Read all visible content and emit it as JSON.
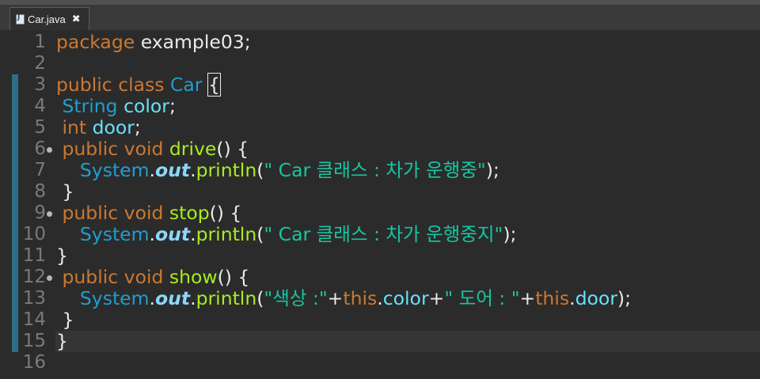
{
  "tab": {
    "label": "Car.java",
    "close": "✖"
  },
  "lines": [
    {
      "num": "1",
      "tokens": [
        {
          "t": "package ",
          "c": "kw"
        },
        {
          "t": "example03",
          "c": "punct"
        },
        {
          "t": ";",
          "c": "punct"
        }
      ]
    },
    {
      "num": "2",
      "tokens": []
    },
    {
      "num": "3",
      "tokens": [
        {
          "t": "public ",
          "c": "kw"
        },
        {
          "t": "class ",
          "c": "kw"
        },
        {
          "t": "Car ",
          "c": "type"
        },
        {
          "t": "{",
          "c": "punct bracket"
        }
      ]
    },
    {
      "num": "4",
      "tokens": [
        {
          "t": " String ",
          "c": "type"
        },
        {
          "t": "color",
          "c": "fld"
        },
        {
          "t": ";",
          "c": "punct"
        }
      ]
    },
    {
      "num": "5",
      "tokens": [
        {
          "t": " int ",
          "c": "kw"
        },
        {
          "t": "door",
          "c": "fld"
        },
        {
          "t": ";",
          "c": "punct"
        }
      ]
    },
    {
      "num": "6",
      "tokens": [
        {
          "t": " public ",
          "c": "kw"
        },
        {
          "t": "void ",
          "c": "kw"
        },
        {
          "t": "drive",
          "c": "meth"
        },
        {
          "t": "() {",
          "c": "punct"
        }
      ]
    },
    {
      "num": "7",
      "tokens": [
        {
          "t": "    System",
          "c": "sys"
        },
        {
          "t": ".",
          "c": "punct"
        },
        {
          "t": "out",
          "c": "out"
        },
        {
          "t": ".",
          "c": "punct"
        },
        {
          "t": "println",
          "c": "meth"
        },
        {
          "t": "(",
          "c": "punct"
        },
        {
          "t": "\" Car 클래스 : 차가 운행중\"",
          "c": "str"
        },
        {
          "t": ");",
          "c": "punct"
        }
      ]
    },
    {
      "num": "8",
      "tokens": [
        {
          "t": " }",
          "c": "punct"
        }
      ]
    },
    {
      "num": "9",
      "tokens": [
        {
          "t": " public ",
          "c": "kw"
        },
        {
          "t": "void ",
          "c": "kw"
        },
        {
          "t": "stop",
          "c": "meth"
        },
        {
          "t": "() {",
          "c": "punct"
        }
      ]
    },
    {
      "num": "10",
      "tokens": [
        {
          "t": "    System",
          "c": "sys"
        },
        {
          "t": ".",
          "c": "punct"
        },
        {
          "t": "out",
          "c": "out"
        },
        {
          "t": ".",
          "c": "punct"
        },
        {
          "t": "println",
          "c": "meth"
        },
        {
          "t": "(",
          "c": "punct"
        },
        {
          "t": "\" Car 클래스 : 차가 운행중지\"",
          "c": "str"
        },
        {
          "t": ");",
          "c": "punct"
        }
      ]
    },
    {
      "num": "11",
      "tokens": [
        {
          "t": "}",
          "c": "punct"
        }
      ]
    },
    {
      "num": "12",
      "tokens": [
        {
          "t": " public ",
          "c": "kw"
        },
        {
          "t": "void ",
          "c": "kw"
        },
        {
          "t": "show",
          "c": "meth"
        },
        {
          "t": "() {",
          "c": "punct"
        }
      ]
    },
    {
      "num": "13",
      "tokens": [
        {
          "t": "    System",
          "c": "sys"
        },
        {
          "t": ".",
          "c": "punct"
        },
        {
          "t": "out",
          "c": "out"
        },
        {
          "t": ".",
          "c": "punct"
        },
        {
          "t": "println",
          "c": "meth"
        },
        {
          "t": "(",
          "c": "punct"
        },
        {
          "t": "\"색상 :\"",
          "c": "str"
        },
        {
          "t": "+",
          "c": "punct"
        },
        {
          "t": "this",
          "c": "kw"
        },
        {
          "t": ".",
          "c": "punct"
        },
        {
          "t": "color",
          "c": "fld"
        },
        {
          "t": "+",
          "c": "punct"
        },
        {
          "t": "\" 도어 : \"",
          "c": "str"
        },
        {
          "t": "+",
          "c": "punct"
        },
        {
          "t": "this",
          "c": "kw"
        },
        {
          "t": ".",
          "c": "punct"
        },
        {
          "t": "door",
          "c": "fld"
        },
        {
          "t": ");",
          "c": "punct"
        }
      ]
    },
    {
      "num": "14",
      "tokens": [
        {
          "t": " }",
          "c": "punct"
        }
      ]
    },
    {
      "num": "15",
      "tokens": [
        {
          "t": "}",
          "c": "punct"
        }
      ]
    },
    {
      "num": "16",
      "tokens": []
    }
  ],
  "folds": [
    "6",
    "9",
    "12"
  ],
  "current_line": "15",
  "colors": {
    "background": "#2b2b2b",
    "keyword": "#cc7832",
    "type": "#1f9ece",
    "method": "#a7ec21",
    "field": "#66e1f8",
    "string": "#17c6a3",
    "change_bar": "#2f6d87"
  },
  "icons": {
    "tab": "java-file-icon",
    "fold": "fold-collapse-icon"
  }
}
